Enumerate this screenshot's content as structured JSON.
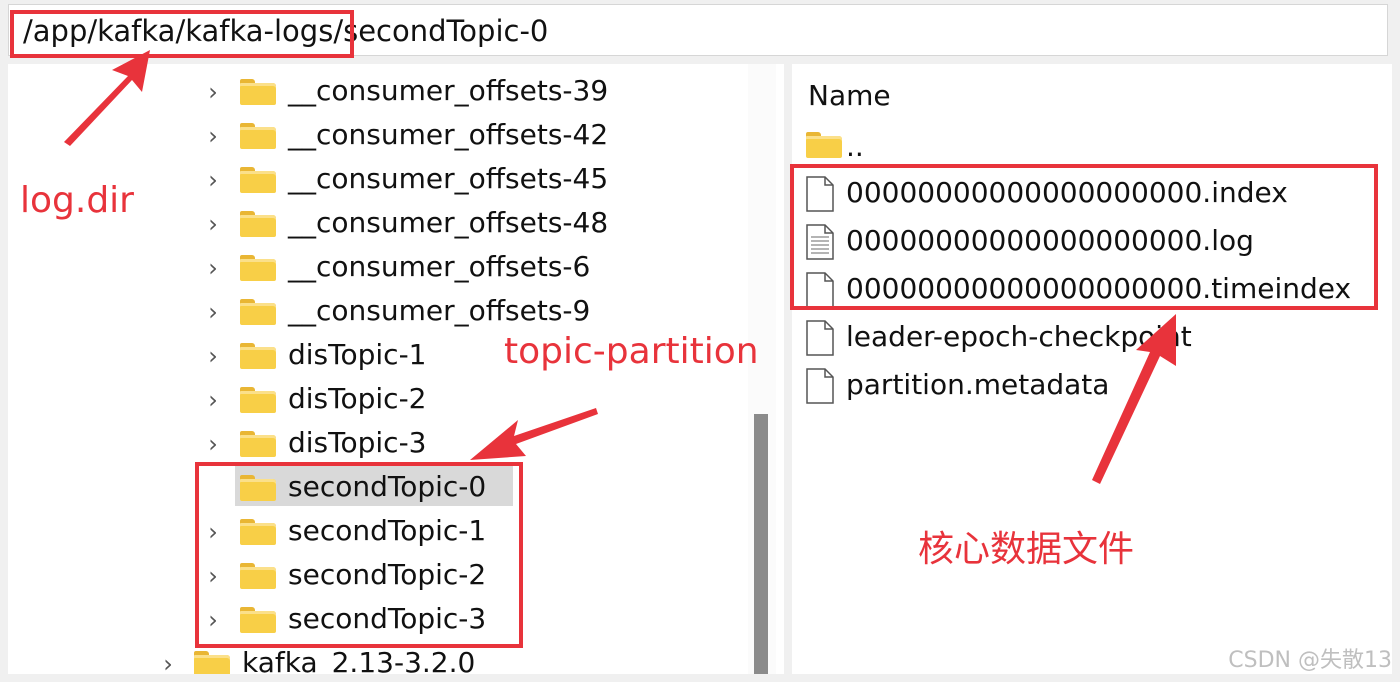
{
  "address_bar": {
    "path": "/app/kafka/kafka-logs/secondTopic-0"
  },
  "tree": {
    "items": [
      {
        "label": "__consumer_offsets-39",
        "expandable": true
      },
      {
        "label": "__consumer_offsets-42",
        "expandable": true
      },
      {
        "label": "__consumer_offsets-45",
        "expandable": true
      },
      {
        "label": "__consumer_offsets-48",
        "expandable": true
      },
      {
        "label": "__consumer_offsets-6",
        "expandable": true
      },
      {
        "label": "__consumer_offsets-9",
        "expandable": true
      },
      {
        "label": "disTopic-1",
        "expandable": true
      },
      {
        "label": "disTopic-2",
        "expandable": true
      },
      {
        "label": "disTopic-3",
        "expandable": true
      },
      {
        "label": "secondTopic-0",
        "expandable": false,
        "selected": true
      },
      {
        "label": "secondTopic-1",
        "expandable": true
      },
      {
        "label": "secondTopic-2",
        "expandable": true
      },
      {
        "label": "secondTopic-3",
        "expandable": true
      }
    ],
    "parent_item": {
      "label": "kafka_2.13-3.2.0",
      "expandable": true
    }
  },
  "file_list": {
    "header": "Name",
    "parent_dir": "..",
    "files": [
      {
        "label": "00000000000000000000.index",
        "icon": "blank-file-icon"
      },
      {
        "label": "00000000000000000000.log",
        "icon": "text-file-icon"
      },
      {
        "label": "00000000000000000000.timeindex",
        "icon": "blank-file-icon"
      },
      {
        "label": "leader-epoch-checkpoint",
        "icon": "blank-file-icon"
      },
      {
        "label": "partition.metadata",
        "icon": "blank-file-icon"
      }
    ]
  },
  "annotations": {
    "log_dir": "log.dir",
    "topic_partition": "topic-partition",
    "core_files": "核心数据文件"
  },
  "watermark": "CSDN @失散13",
  "colors": {
    "annotation_red": "#e8333b",
    "folder_yellow": "#f8cf47",
    "selection_gray": "#d9d9d9"
  }
}
